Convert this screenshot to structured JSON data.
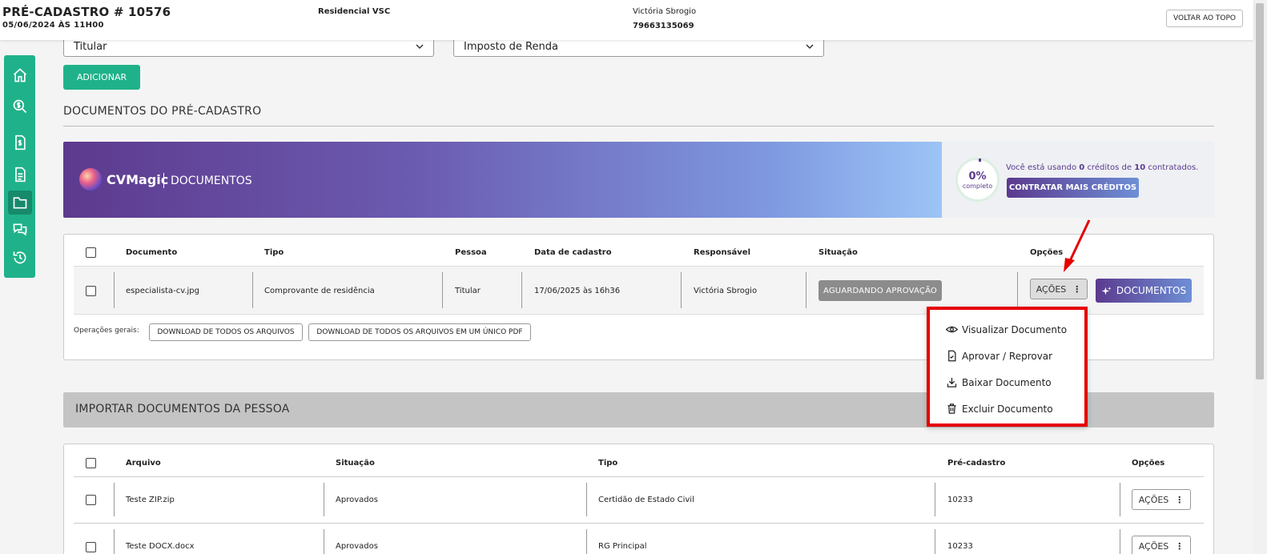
{
  "header": {
    "title": "PRÉ-CADASTRO # 10576",
    "date": "05/06/2024 ÀS 11H00",
    "empreendimento": "Residencial VSC",
    "cliente_nome": "Victória Sbrogio",
    "cliente_telefone": "79663135069",
    "voltar_label": "VOLTAR AO TOPO"
  },
  "sidebar": {
    "items": [
      {
        "icon": "home-icon"
      },
      {
        "icon": "search-money-icon"
      },
      {
        "icon": "money-document-icon"
      },
      {
        "icon": "document-icon"
      },
      {
        "icon": "folder-icon",
        "active": true
      },
      {
        "icon": "chat-icon"
      },
      {
        "icon": "history-icon"
      }
    ]
  },
  "form": {
    "select_pessoa": "Titular",
    "select_tipo": "Imposto de Renda",
    "add_label": "ADICIONAR"
  },
  "documentos": {
    "section_title": "DOCUMENTOS DO PRÉ-CADASTRO",
    "banner": {
      "brand": "CVMagic",
      "sub": "DOCUMENTOS",
      "percent": "0%",
      "percent_label": "completo",
      "credits_prefix": "Você está usando",
      "credits_used": "0",
      "credits_mid": "créditos de",
      "credits_total": "10",
      "credits_suffix": "contratados.",
      "buy_label": "CONTRATAR MAIS CRÉDITOS"
    },
    "columns": [
      "Documento",
      "Tipo",
      "Pessoa",
      "Data de cadastro",
      "Responsável",
      "Situação",
      "Opções"
    ],
    "rows": [
      {
        "documento": "especialista-cv.jpg",
        "tipo": "Comprovante de residência",
        "pessoa": "Titular",
        "data": "17/06/2025 às 16h36",
        "responsavel": "Victória Sbrogio",
        "situacao": "AGUARDANDO APROVAÇÃO",
        "acoes_label": "AÇÕES",
        "docs_label": "DOCUMENTOS"
      }
    ],
    "operacoes_label": "Operações gerais:",
    "download_all": "DOWNLOAD DE TODOS OS ARQUIVOS",
    "download_pdf": "DOWNLOAD DE TODOS OS ARQUIVOS EM UM ÚNICO PDF"
  },
  "menu": {
    "items": [
      {
        "label": "Visualizar Documento",
        "icon": "eye-icon"
      },
      {
        "label": "Aprovar / Reprovar",
        "icon": "file-check-icon"
      },
      {
        "label": "Baixar Documento",
        "icon": "download-icon"
      },
      {
        "label": "Excluir Documento",
        "icon": "trash-icon"
      }
    ]
  },
  "importar": {
    "section_title": "IMPORTAR DOCUMENTOS DA PESSOA",
    "columns": [
      "Arquivo",
      "Situação",
      "Tipo",
      "Pré-cadastro",
      "Opções"
    ],
    "rows": [
      {
        "arquivo": "Teste ZIP.zip",
        "situacao": "Aprovados",
        "tipo": "Certidão de Estado Civil",
        "precadastro": "10233",
        "acoes_label": "AÇÕES"
      },
      {
        "arquivo": "Teste DOCX.docx",
        "situacao": "Aprovados",
        "tipo": "RG Principal",
        "precadastro": "10233",
        "acoes_label": "AÇÕES"
      }
    ]
  },
  "colors": {
    "green": "#1fb28a",
    "purple": "#5b3a8e",
    "highlight_red": "#e60000"
  }
}
